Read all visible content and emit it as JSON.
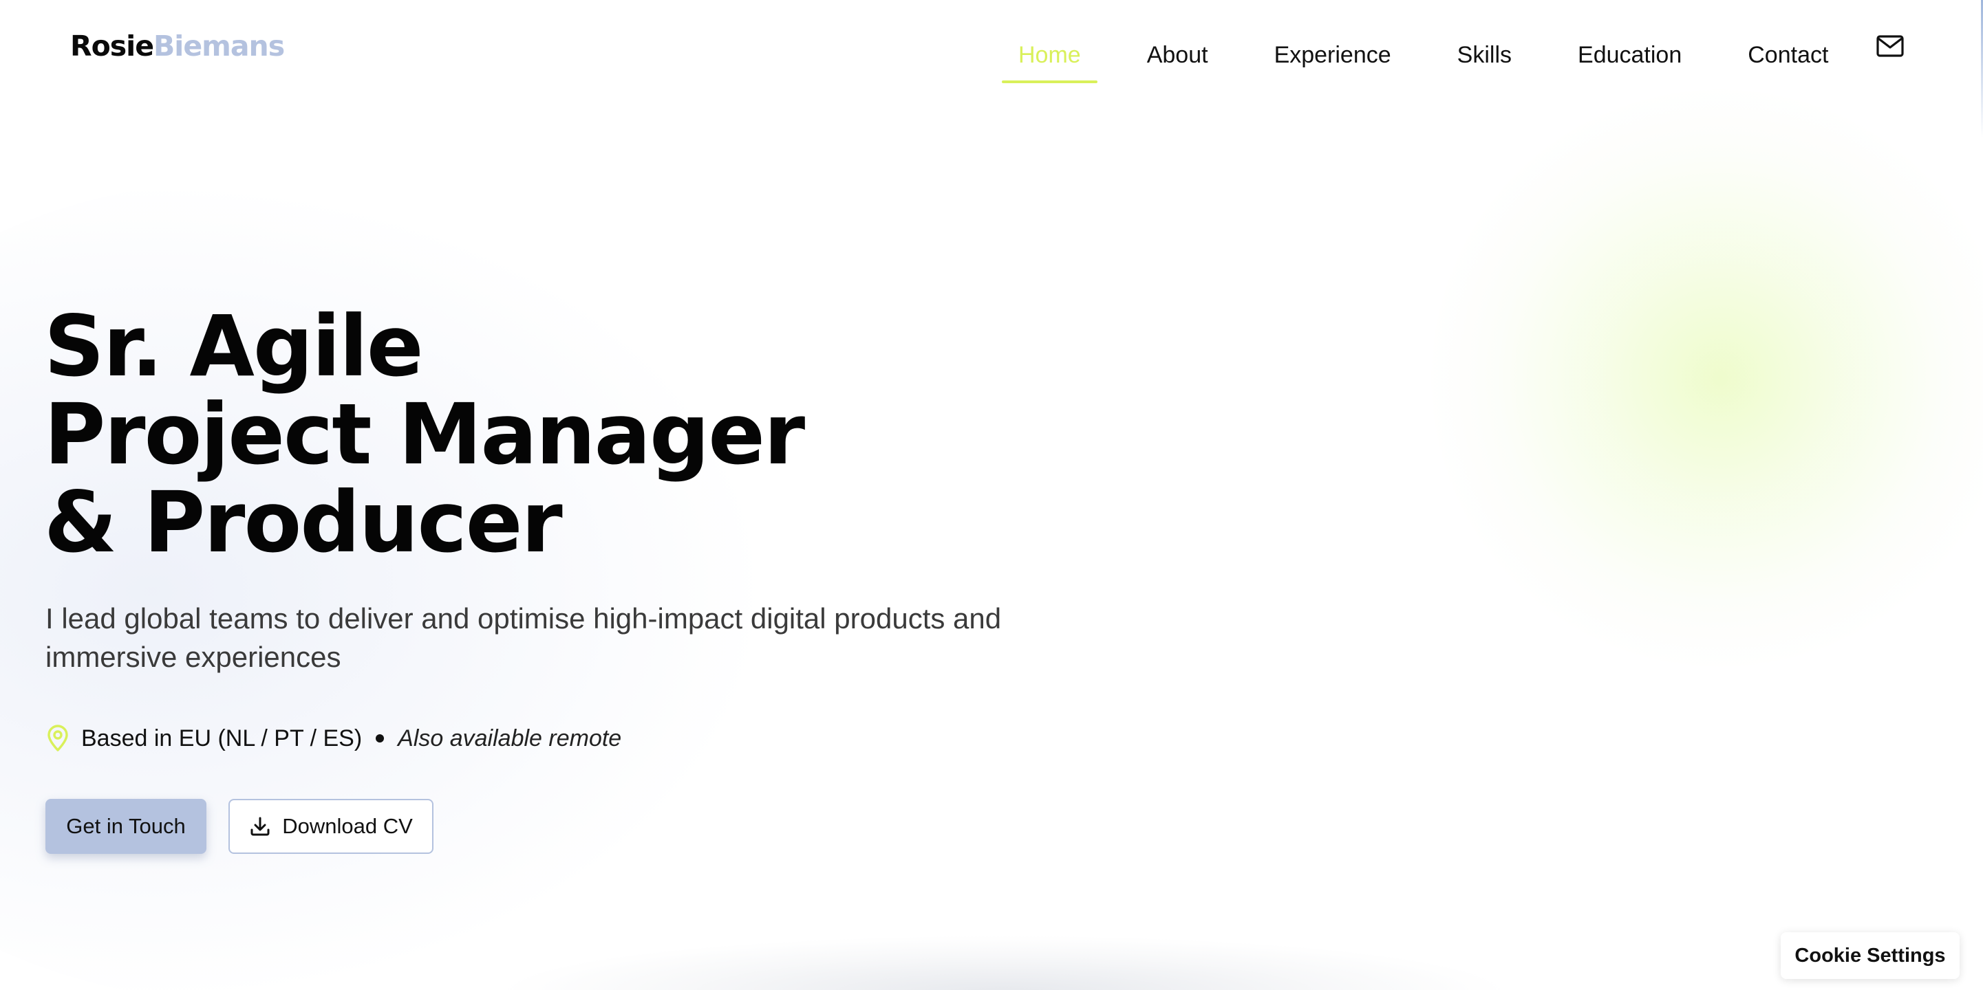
{
  "header": {
    "logo_first": "Rosie",
    "logo_last": "Biemans",
    "nav": [
      {
        "label": "Home",
        "active": true
      },
      {
        "label": "About",
        "active": false
      },
      {
        "label": "Experience",
        "active": false
      },
      {
        "label": "Skills",
        "active": false
      },
      {
        "label": "Education",
        "active": false
      },
      {
        "label": "Contact",
        "active": false
      }
    ],
    "mail_icon": "mail-icon"
  },
  "hero": {
    "title_lines": [
      "Sr. Agile",
      "Project Manager",
      "& Producer"
    ],
    "subtitle": "I lead global teams to deliver and optimise high-impact digital products and immersive experiences",
    "location": "Based in EU (NL / PT / ES)",
    "remote": "Also available remote",
    "location_icon": "map-pin-icon",
    "primary_button": "Get in Touch",
    "secondary_button": "Download CV",
    "download_icon": "download-icon"
  },
  "cookie": {
    "label": "Cookie Settings"
  },
  "colors": {
    "accent_lime": "#d9f05a",
    "brand_blue": "#b4c2df",
    "text_dark": "#111111"
  }
}
